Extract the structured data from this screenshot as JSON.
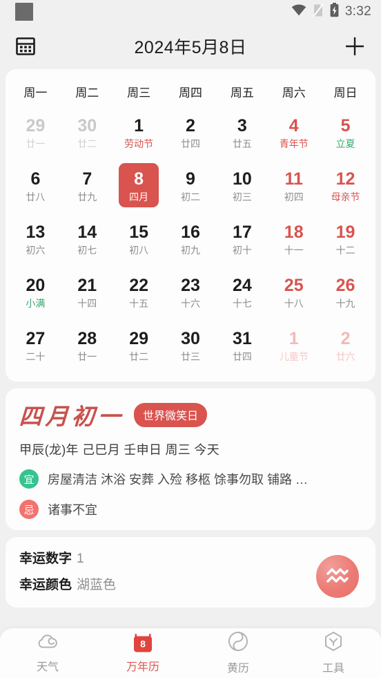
{
  "statusbar": {
    "time": "3:32",
    "icons": [
      "wifi-icon",
      "no-sim-icon",
      "battery-charging-icon"
    ]
  },
  "topbar": {
    "title": "2024年5月8日",
    "left_icon": "calendar-view-icon",
    "right_icon": "plus-icon"
  },
  "calendar": {
    "weekdays": [
      "周一",
      "周二",
      "周三",
      "周四",
      "周五",
      "周六",
      "周日"
    ],
    "selected_color": "#d9534f",
    "weeks": [
      [
        {
          "num": "29",
          "sub": "廿一",
          "state": "other"
        },
        {
          "num": "30",
          "sub": "廿二",
          "state": "other"
        },
        {
          "num": "1",
          "sub": "劳动节",
          "sub_kind": "fest"
        },
        {
          "num": "2",
          "sub": "廿四"
        },
        {
          "num": "3",
          "sub": "廿五"
        },
        {
          "num": "4",
          "sub": "青年节",
          "sub_kind": "fest",
          "weekend": true
        },
        {
          "num": "5",
          "sub": "立夏",
          "sub_kind": "solar",
          "weekend": true
        }
      ],
      [
        {
          "num": "6",
          "sub": "廿八"
        },
        {
          "num": "7",
          "sub": "廿九"
        },
        {
          "num": "8",
          "sub": "四月",
          "selected": true
        },
        {
          "num": "9",
          "sub": "初二"
        },
        {
          "num": "10",
          "sub": "初三"
        },
        {
          "num": "11",
          "sub": "初四",
          "weekend": true
        },
        {
          "num": "12",
          "sub": "母亲节",
          "sub_kind": "fest",
          "weekend": true
        }
      ],
      [
        {
          "num": "13",
          "sub": "初六"
        },
        {
          "num": "14",
          "sub": "初七"
        },
        {
          "num": "15",
          "sub": "初八"
        },
        {
          "num": "16",
          "sub": "初九"
        },
        {
          "num": "17",
          "sub": "初十"
        },
        {
          "num": "18",
          "sub": "十一",
          "weekend": true
        },
        {
          "num": "19",
          "sub": "十二",
          "weekend": true
        }
      ],
      [
        {
          "num": "20",
          "sub": "小满",
          "sub_kind": "solar"
        },
        {
          "num": "21",
          "sub": "十四"
        },
        {
          "num": "22",
          "sub": "十五"
        },
        {
          "num": "23",
          "sub": "十六"
        },
        {
          "num": "24",
          "sub": "十七"
        },
        {
          "num": "25",
          "sub": "十八",
          "weekend": true
        },
        {
          "num": "26",
          "sub": "十九",
          "weekend": true
        }
      ],
      [
        {
          "num": "27",
          "sub": "二十"
        },
        {
          "num": "28",
          "sub": "廿一"
        },
        {
          "num": "29",
          "sub": "廿二"
        },
        {
          "num": "30",
          "sub": "廿三"
        },
        {
          "num": "31",
          "sub": "廿四"
        },
        {
          "num": "1",
          "sub": "儿童节",
          "sub_kind": "festlight",
          "state": "other",
          "weekend": true
        },
        {
          "num": "2",
          "sub": "廿六",
          "state": "other",
          "weekend": true
        }
      ]
    ]
  },
  "detail": {
    "lunar_date": "四月初一",
    "festival_badge": "世界微笑日",
    "ganzhi": "甲辰(龙)年 己巳月 壬申日 周三  今天",
    "yi": {
      "badge": "宜",
      "text": "房屋清洁 沐浴 安葬 入殓 移柩 馀事勿取 铺路 …",
      "color": "#35c48f"
    },
    "ji": {
      "badge": "忌",
      "text": "诸事不宜",
      "color": "#f4726e"
    }
  },
  "lucky": {
    "lines": [
      {
        "label": "幸运数字",
        "value": "1"
      },
      {
        "label": "幸运颜色",
        "value": "湖蓝色"
      }
    ],
    "zodiac_icon": "aquarius-icon"
  },
  "bottomnav": {
    "items": [
      {
        "label": "天气",
        "icon": "cloud-icon",
        "active": false
      },
      {
        "label": "万年历",
        "icon": "calendar-day-icon",
        "badge": "8",
        "active": true
      },
      {
        "label": "黄历",
        "icon": "yinyang-icon",
        "active": false
      },
      {
        "label": "工具",
        "icon": "tools-hex-icon",
        "active": false
      }
    ]
  }
}
